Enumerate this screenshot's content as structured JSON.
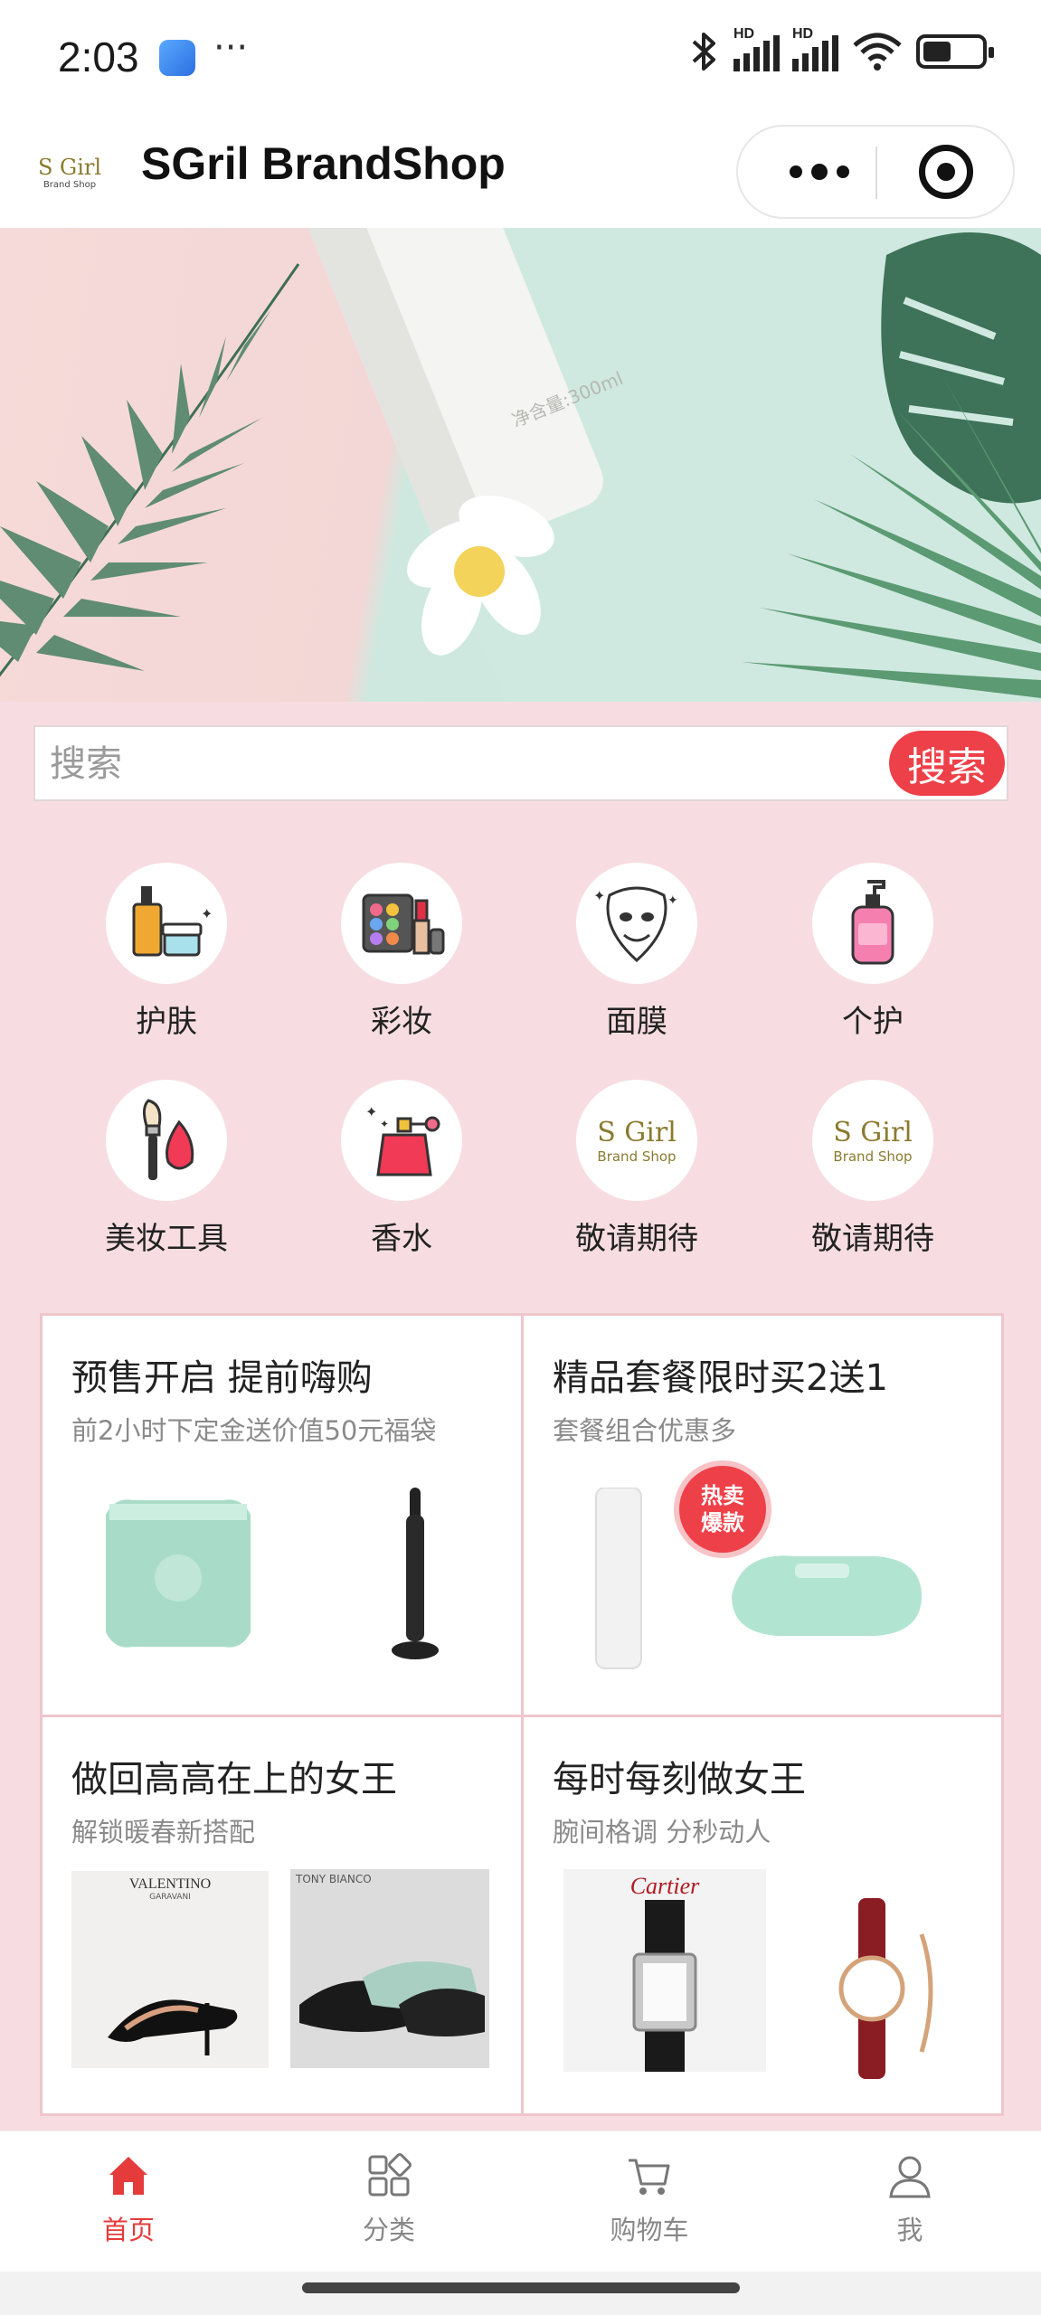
{
  "status_bar": {
    "time": "2:03",
    "dots": "···",
    "hd_label": "HD",
    "icons": [
      "app-notification-icon",
      "bluetooth-icon",
      "signal-icon",
      "wifi-icon",
      "battery-icon"
    ]
  },
  "header": {
    "logo_text": "S Girl",
    "logo_sub": "Brand Shop",
    "title": "SGril BrandShop",
    "more_icon": "more-dots-icon",
    "close_icon": "target-close-icon"
  },
  "search": {
    "placeholder": "搜索",
    "button_label": "搜索"
  },
  "categories": [
    {
      "label": "护肤",
      "icon": "skincare-icon"
    },
    {
      "label": "彩妆",
      "icon": "makeup-palette-icon"
    },
    {
      "label": "面膜",
      "icon": "face-mask-icon"
    },
    {
      "label": "个护",
      "icon": "lotion-bottle-icon"
    },
    {
      "label": "美妆工具",
      "icon": "brush-sponge-icon"
    },
    {
      "label": "香水",
      "icon": "perfume-icon"
    },
    {
      "label": "敬请期待",
      "icon": "brand-logo-icon"
    },
    {
      "label": "敬请期待",
      "icon": "brand-logo-icon"
    }
  ],
  "promo": {
    "cells": [
      {
        "title": "预售开启 提前嗨购",
        "subtitle": "前2小时下定金送价值50元福袋"
      },
      {
        "title": "精品套餐限时买2送1",
        "subtitle": "套餐组合优惠多",
        "badge_line1": "热卖",
        "badge_line2": "爆款"
      },
      {
        "title": "做回高高在上的女王",
        "subtitle": "解锁暖春新搭配",
        "img1_brand": "VALENTINO",
        "img1_brand_sub": "GARAVANI",
        "img2_brand": "TONY BIANCO"
      },
      {
        "title": "每时每刻做女王",
        "subtitle": "腕间格调 分秒动人",
        "img1_brand": "Cartier"
      }
    ]
  },
  "banner": {
    "bottle_text": "净含量:300ml"
  },
  "tabbar": {
    "tabs": [
      {
        "label": "首页",
        "icon": "home-icon",
        "active": true
      },
      {
        "label": "分类",
        "icon": "category-grid-icon",
        "active": false
      },
      {
        "label": "购物车",
        "icon": "cart-icon",
        "active": false
      },
      {
        "label": "我",
        "icon": "profile-icon",
        "active": false
      }
    ]
  },
  "colors": {
    "accent": "#ee4048",
    "page_bg": "#f7dde1",
    "promo_border": "#f0c5cb"
  }
}
